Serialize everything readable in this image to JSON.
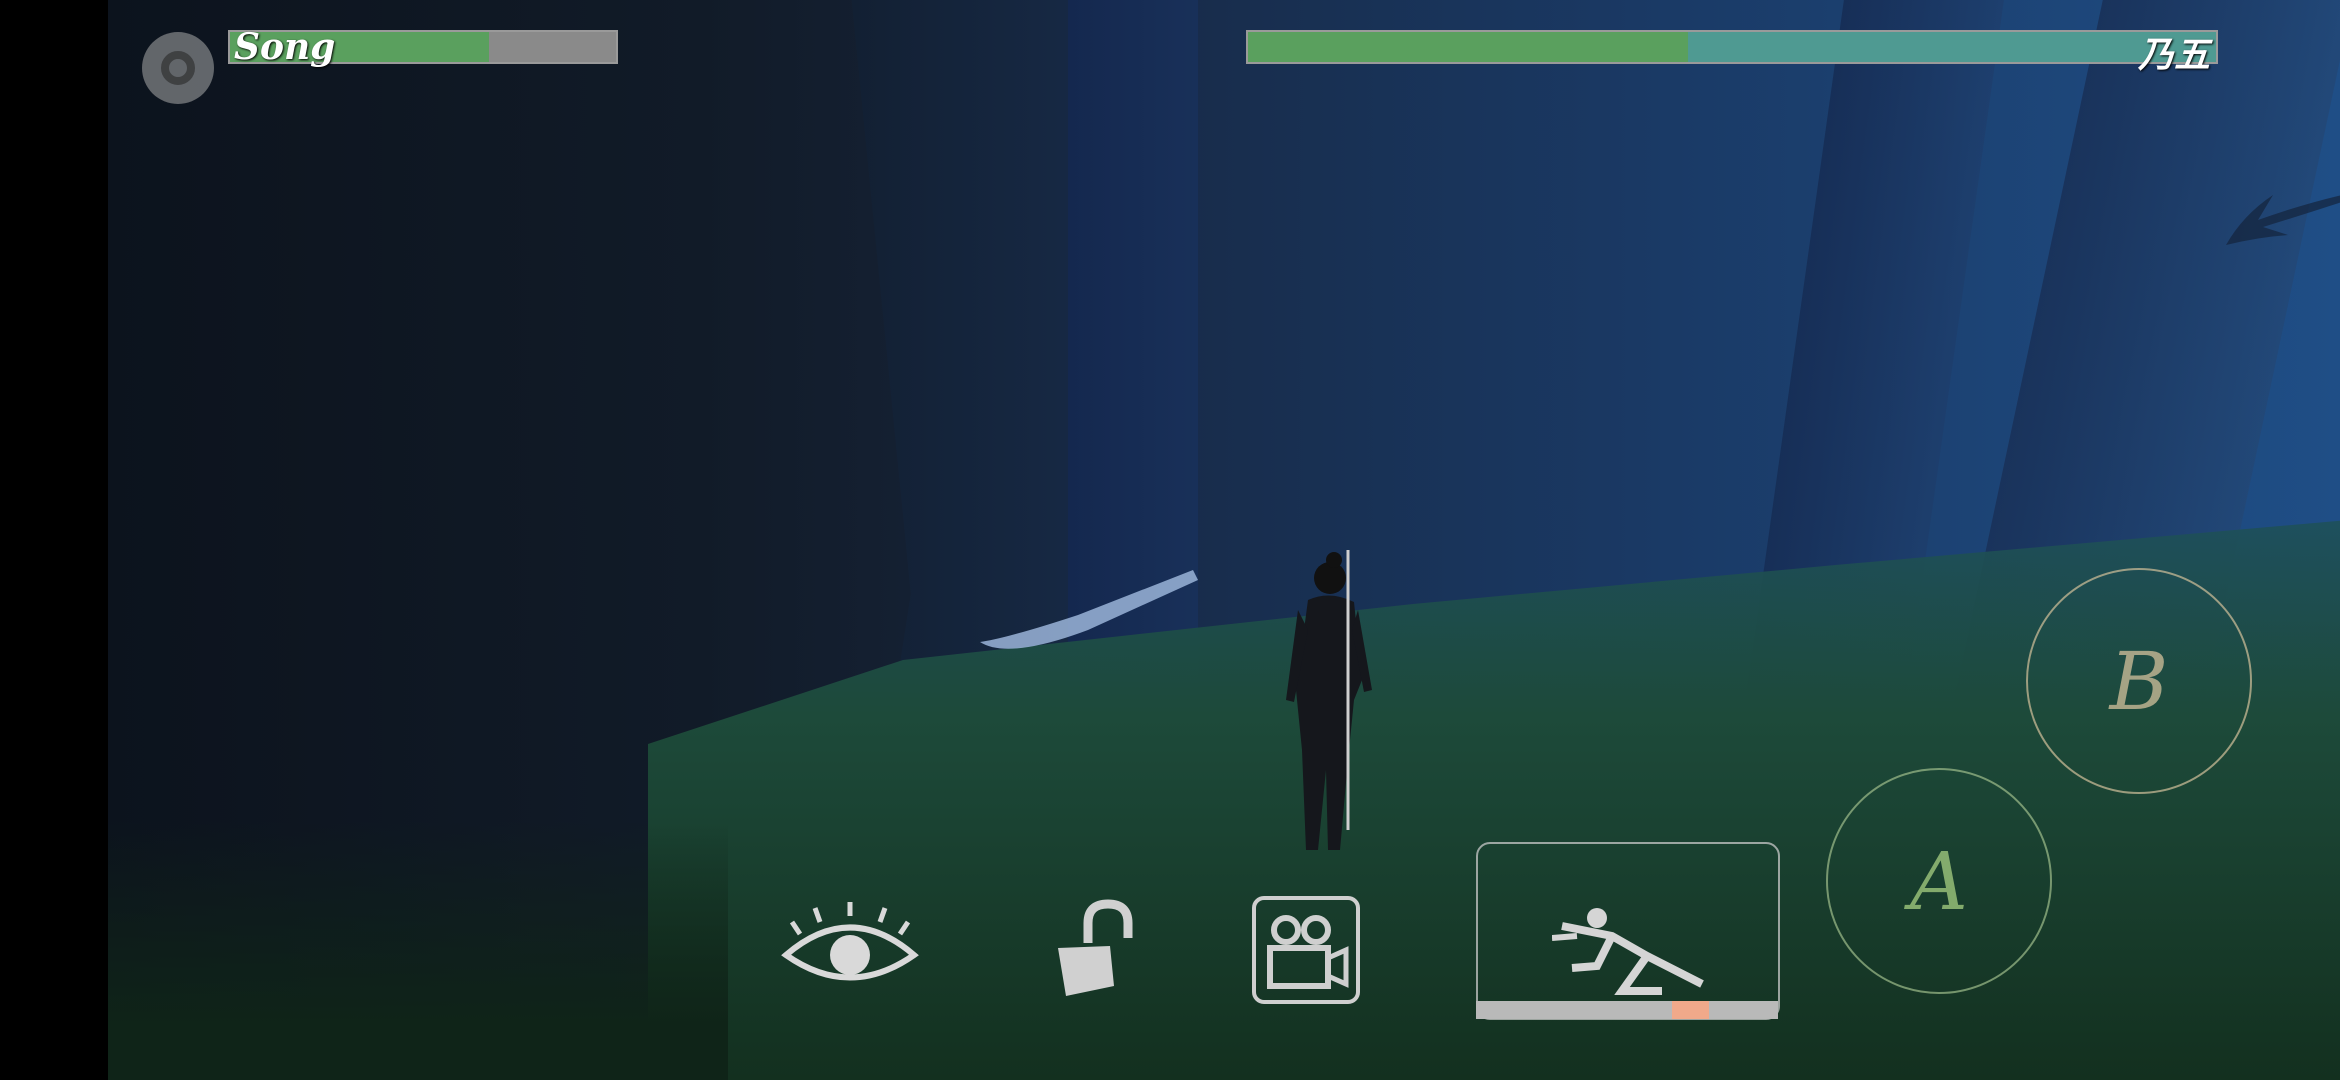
{
  "hud": {
    "player": {
      "name": "Song",
      "health": 0.67,
      "fill_color": "#5aa05e"
    },
    "enemy": {
      "name": "乃五",
      "health_primary": 0.455,
      "health_secondary": 0.545,
      "colors": [
        "#5aa05e",
        "#4f9a92"
      ]
    },
    "menu_icon": "settings-ring-icon",
    "actions": {
      "b_label": "B",
      "a_label": "A",
      "dash_icon": "dash-runner-icon",
      "look_icon": "eye-icon",
      "lock_icon": "unlock-padlock-icon",
      "camera_icon": "video-camera-icon"
    },
    "stamina": {
      "marker_start": 0.65,
      "marker_width": 0.12,
      "marker_color": "#f0a98a"
    }
  },
  "scene": {
    "description_icon": "forest-scene"
  }
}
